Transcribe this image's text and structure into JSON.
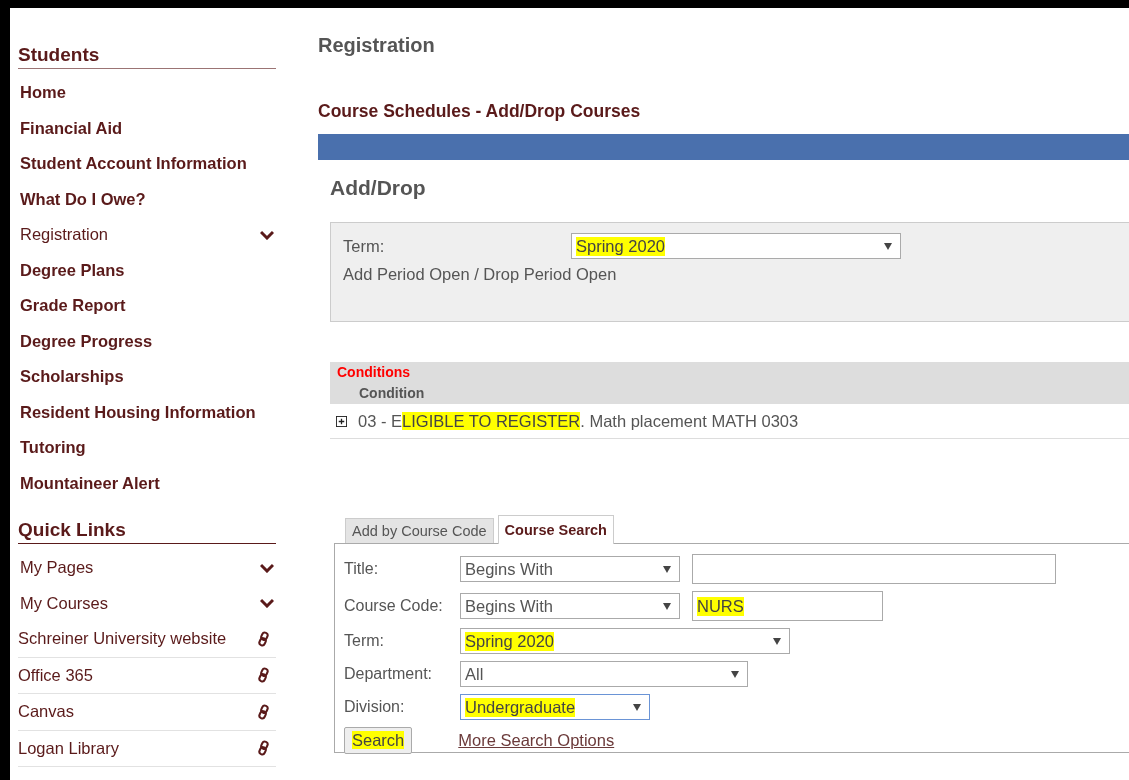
{
  "sidebar": {
    "sections": [
      {
        "title": "Students",
        "items": [
          {
            "label": "Home",
            "kind": "bold"
          },
          {
            "label": "Financial Aid",
            "kind": "bold"
          },
          {
            "label": "Student Account Information",
            "kind": "bold"
          },
          {
            "label": "What Do I Owe?",
            "kind": "bold"
          },
          {
            "label": "Registration",
            "kind": "menu",
            "expanded": false
          },
          {
            "label": "Degree Plans",
            "kind": "bold"
          },
          {
            "label": "Grade Report",
            "kind": "bold"
          },
          {
            "label": "Degree Progress",
            "kind": "bold"
          },
          {
            "label": "Scholarships",
            "kind": "bold"
          },
          {
            "label": "Resident Housing Information",
            "kind": "bold"
          },
          {
            "label": "Tutoring",
            "kind": "bold"
          },
          {
            "label": "Mountaineer Alert",
            "kind": "bold"
          }
        ]
      },
      {
        "title": "Quick Links",
        "items": [
          {
            "label": "My Pages",
            "kind": "menu",
            "expanded": false
          },
          {
            "label": "My Courses",
            "kind": "menu",
            "expanded": false
          },
          {
            "label": "Schreiner University website",
            "kind": "link"
          },
          {
            "label": "Office 365",
            "kind": "link"
          },
          {
            "label": "Canvas",
            "kind": "link"
          },
          {
            "label": "Logan Library",
            "kind": "link"
          }
        ]
      }
    ]
  },
  "page": {
    "title": "Registration",
    "subtitle": "Course Schedules - Add/Drop Courses",
    "heading": "Add/Drop"
  },
  "term_panel": {
    "label": "Term:",
    "value": "Spring 2020",
    "highlighted": true,
    "status": "Add Period Open / Drop Period Open"
  },
  "conditions": {
    "title": "Conditions",
    "column": "Condition",
    "rows": [
      {
        "expanded": false,
        "segments": [
          {
            "text": "03 - E",
            "highlighted": false
          },
          {
            "text": "LIGIBLE TO REGISTER",
            "highlighted": true
          },
          {
            "text": ". Math placement MATH 0303",
            "highlighted": false
          }
        ]
      }
    ]
  },
  "tabs": [
    {
      "label": "Add by Course Code",
      "selected": false
    },
    {
      "label": "Course Search",
      "selected": true
    }
  ],
  "search_form": {
    "rows": [
      {
        "label": "Title:",
        "operator": "Begins With",
        "highlighted": false,
        "kind": "text"
      },
      {
        "label": "Course Code:",
        "operator": "Begins With",
        "value": "NURS",
        "highlighted": true,
        "kind": "text"
      },
      {
        "label": "Term:",
        "value": "Spring 2020",
        "highlighted": true,
        "kind": "select",
        "focused": false
      },
      {
        "label": "Department:",
        "value": "All",
        "highlighted": false,
        "kind": "select",
        "focused": false
      },
      {
        "label": "Division:",
        "value": "Undergraduate",
        "highlighted": true,
        "kind": "select",
        "focused": true
      }
    ],
    "search_button": {
      "label": "Search",
      "highlighted": true
    },
    "more_link": "More Search Options"
  }
}
